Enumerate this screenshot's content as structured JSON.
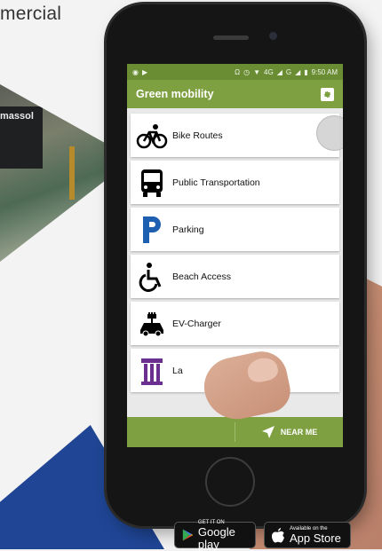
{
  "heading_fragment": "mercial",
  "photo_sign_text": "massol",
  "status_bar": {
    "time": "9:50 AM",
    "network": "4G",
    "signal_text": "G"
  },
  "app": {
    "title": "Green mobility",
    "items": [
      {
        "label": "Bike Routes",
        "icon": "bicycle-icon"
      },
      {
        "label": "Public Transportation",
        "icon": "bus-icon"
      },
      {
        "label": "Parking",
        "icon": "parking-icon"
      },
      {
        "label": "Beach Access",
        "icon": "wheelchair-icon"
      },
      {
        "label": "EV-Charger",
        "icon": "ev-charger-icon"
      },
      {
        "label": "La",
        "icon": "column-icon"
      }
    ],
    "near_me_label": "NEAR ME"
  },
  "badges": {
    "google_small": "GET IT ON",
    "google_big": "Google play",
    "apple_small": "Available on the",
    "apple_big": "App Store"
  },
  "colors": {
    "appbar": "#7ea041",
    "statusbar": "#6a8d34",
    "parking_blue": "#1d5fb0",
    "column_purple": "#6b2f8f",
    "wedge_blue": "#1f4594"
  }
}
